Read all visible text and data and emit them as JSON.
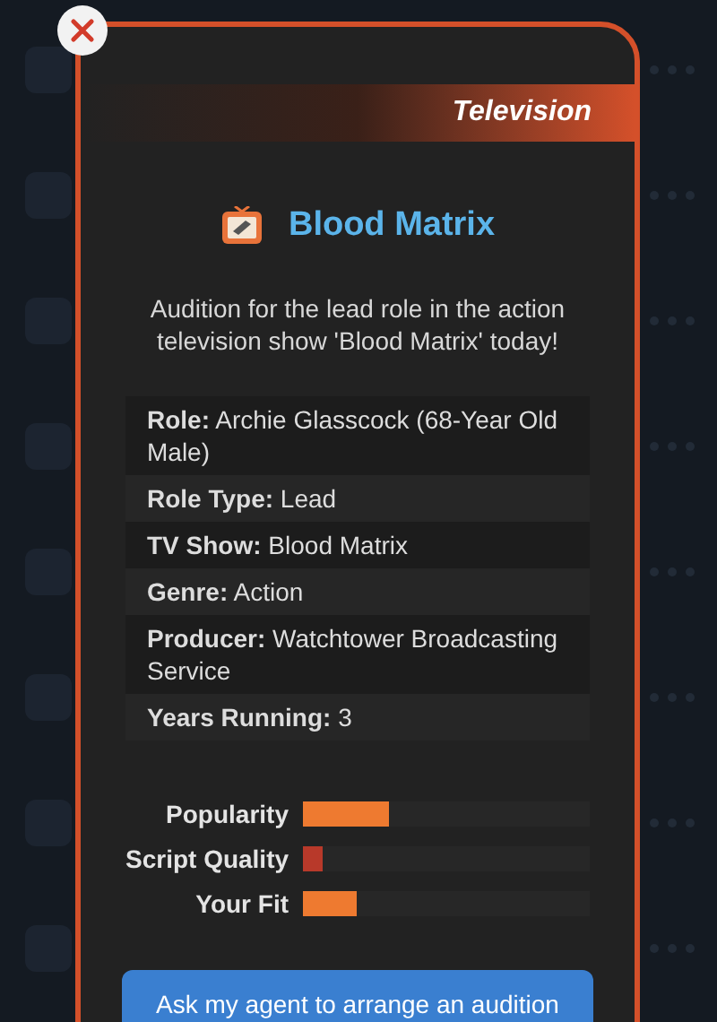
{
  "category": "Television",
  "title": "Blood Matrix",
  "description": "Audition for the lead role in the action television show 'Blood Matrix' today!",
  "details": [
    {
      "label": "Role:",
      "value": "Archie Glasscock (68-Year Old Male)"
    },
    {
      "label": "Role Type:",
      "value": "Lead"
    },
    {
      "label": "TV Show:",
      "value": "Blood Matrix"
    },
    {
      "label": "Genre:",
      "value": "Action"
    },
    {
      "label": "Producer:",
      "value": "Watchtower Broadcasting Service"
    },
    {
      "label": "Years Running:",
      "value": "3"
    }
  ],
  "ratings": [
    {
      "label": "Popularity",
      "level": 0.3,
      "color": "#ee7a30"
    },
    {
      "label": "Script Quality",
      "level": 0.07,
      "color": "#b8392a"
    },
    {
      "label": "Your Fit",
      "level": 0.19,
      "color": "#ee7a30"
    }
  ],
  "action_button": "Ask my agent to arrange an audition"
}
